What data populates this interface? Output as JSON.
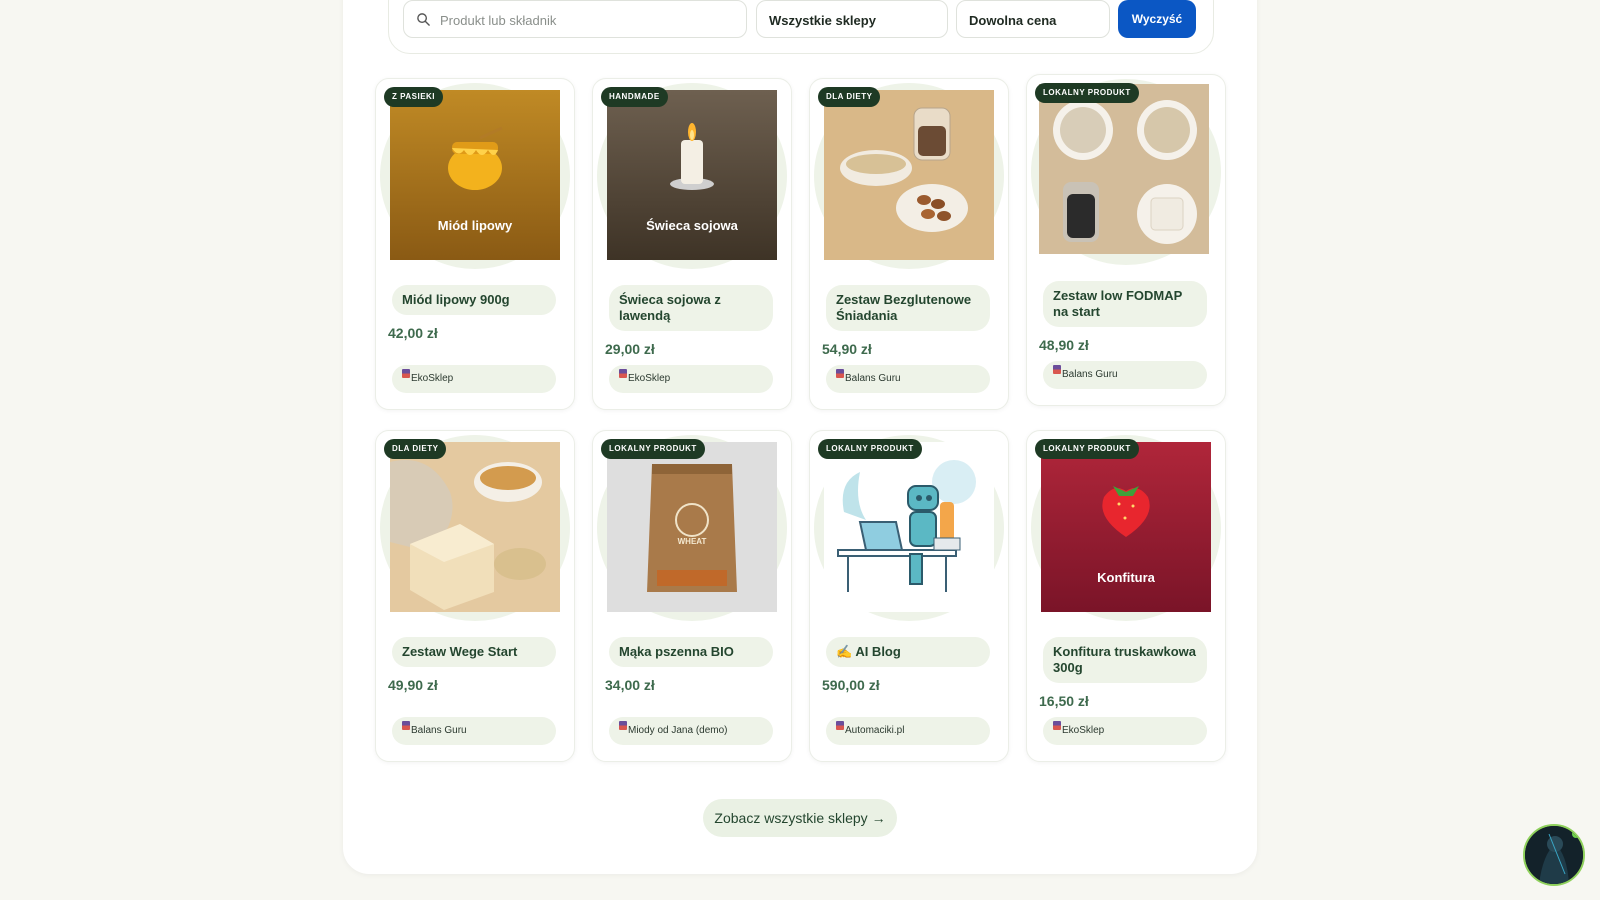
{
  "filters": {
    "search_placeholder": "Produkt lub składnik",
    "store_select": "Wszystkie sklepy",
    "price_select": "Dowolna cena",
    "clear_label": "Wyczyść"
  },
  "products": [
    {
      "badge": "Z PASIEKI",
      "name": "Miód lipowy 900g",
      "price": "42,00 zł",
      "shop": "EkoSklep",
      "image_label": "Miód lipowy"
    },
    {
      "badge": "HANDMADE",
      "name": "Świeca sojowa z lawendą",
      "price": "29,00 zł",
      "shop": "EkoSklep",
      "image_label": "Świeca sojowa"
    },
    {
      "badge": "DLA DIETY",
      "name": "Zestaw Bezglutenowe Śniadania",
      "price": "54,90 zł",
      "shop": "Balans Guru"
    },
    {
      "badge": "LOKALNY PRODUKT",
      "name": "Zestaw low FODMAP na start",
      "price": "48,90 zł",
      "shop": "Balans Guru"
    },
    {
      "badge": "DLA DIETY",
      "name": "Zestaw Wege Start",
      "price": "49,90 zł",
      "shop": "Balans Guru"
    },
    {
      "badge": "LOKALNY PRODUKT",
      "name": "Mąka pszenna BIO",
      "price": "34,00 zł",
      "shop": "Miody od Jana (demo)",
      "image_label": "WHEAT"
    },
    {
      "badge": "LOKALNY PRODUKT",
      "name": "✍️ AI Blog",
      "price": "590,00 zł",
      "shop": "Automaciki.pl"
    },
    {
      "badge": "LOKALNY PRODUKT",
      "name": "Konfitura truskawkowa 300g",
      "price": "16,50 zł",
      "shop": "EkoSklep",
      "image_label": "Konfitura"
    }
  ],
  "see_all_label": "Zobacz wszystkie sklepy →",
  "colors": {
    "accent": "#0b57c4",
    "badge": "#1e3a24",
    "pill": "#eef3e8",
    "price": "#3e6a4d"
  },
  "icons": [
    "search-icon",
    "shop-icon",
    "chat-avatar"
  ]
}
